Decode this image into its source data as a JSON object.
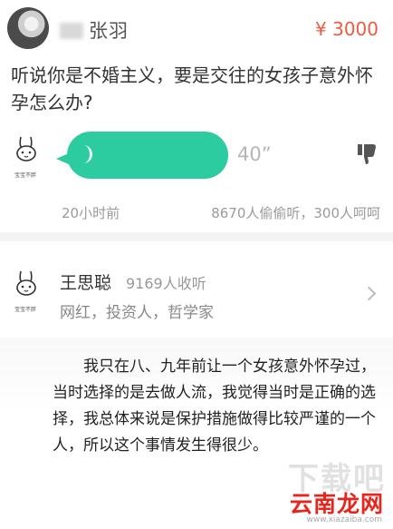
{
  "question": {
    "asker_name": "张羽",
    "price": "¥ 3000",
    "text": "听说你是不婚主义，要是交往的女孩子意外怀孕怎么办?"
  },
  "answer": {
    "avatar_caption": "宝宝不胖",
    "duration": "40”",
    "time_ago": "20小时前",
    "stats": "8670人偷偷听，300人呵呵"
  },
  "answerer": {
    "name": "王思聪",
    "followers": "9169人收听",
    "title": "网红，投资人，哲学家",
    "avatar_caption": "宝宝不胖"
  },
  "transcript": "我只在八、九年前让一个女孩意外怀孕过，当时选择的是去做人流，我觉得当时是正确的选择，我总体来说是保护措施做得比较严谨的一个人，所以这个事情发生得很少。",
  "watermark": {
    "faint": "下载吧",
    "logo": "云南龙网",
    "url": "www.xiazaiba.com"
  },
  "colors": {
    "accent": "#2dcca0",
    "price": "#ef5b3f"
  },
  "icons": [
    "avatar",
    "bunny-avatar-icon",
    "voice-wave-icon",
    "dislike-icon",
    "chevron-right-icon"
  ]
}
